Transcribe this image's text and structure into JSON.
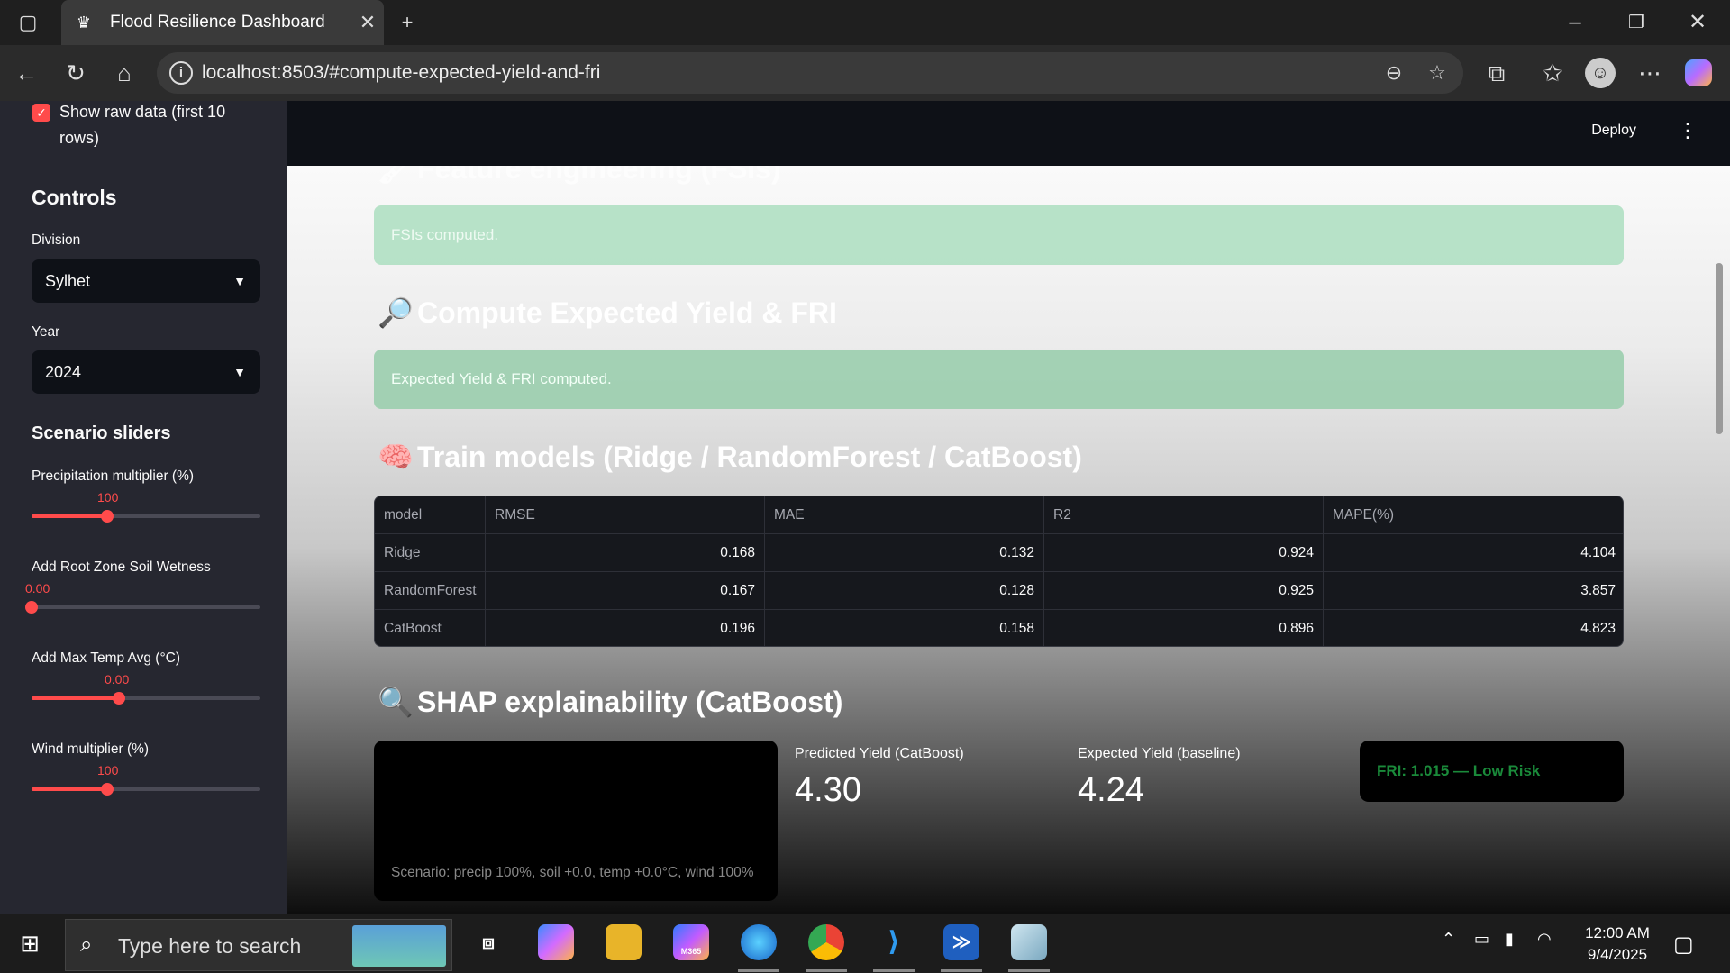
{
  "browser": {
    "tab_title": "Flood Resilience Dashboard",
    "url": "localhost:8503/#compute-expected-yield-and-fri"
  },
  "app": {
    "deploy_label": "Deploy"
  },
  "sidebar": {
    "show_raw_label": "Show raw data (first 10 rows)",
    "show_raw_checked": true,
    "controls_title": "Controls",
    "division_label": "Division",
    "division_value": "Sylhet",
    "year_label": "Year",
    "year_value": "2024",
    "scenario_title": "Scenario sliders",
    "sliders": [
      {
        "label": "Precipitation multiplier (%)",
        "value": "100",
        "fraction": 0.33
      },
      {
        "label": "Add Root Zone Soil Wetness",
        "value": "0.00",
        "fraction": 0.0
      },
      {
        "label": "Add Max Temp Avg (°C)",
        "value": "0.00",
        "fraction": 0.38
      },
      {
        "label": "Wind multiplier (%)",
        "value": "100",
        "fraction": 0.33
      }
    ]
  },
  "main": {
    "section_fsi_title": "Feature engineering (FSIs)",
    "fsi_alert": "FSIs computed.",
    "section_fri_title": "Compute Expected Yield & FRI",
    "fri_alert": "Expected Yield & FRI computed.",
    "section_train_title": "Train models (Ridge / RandomForest / CatBoost)",
    "table": {
      "columns": [
        "model",
        "RMSE",
        "MAE",
        "R2",
        "MAPE(%)"
      ],
      "rows": [
        [
          "Ridge",
          "0.168",
          "0.132",
          "0.924",
          "4.104"
        ],
        [
          "RandomForest",
          "0.167",
          "0.128",
          "0.925",
          "3.857"
        ],
        [
          "CatBoost",
          "0.196",
          "0.158",
          "0.896",
          "4.823"
        ]
      ]
    },
    "section_shap_title": "SHAP explainability (CatBoost)",
    "scenario_caption": "Scenario: precip 100%, soil +0.0, temp +0.0°C, wind 100%",
    "metric_pred_label": "Predicted Yield (CatBoost)",
    "metric_pred_value": "4.30",
    "metric_exp_label": "Expected Yield (baseline)",
    "metric_exp_value": "4.24",
    "fri_result": "FRI: 1.015 — Low Risk"
  },
  "taskbar": {
    "search_placeholder": "Type here to search",
    "time": "12:00 AM",
    "date": "9/4/2025",
    "m365_label": "M365"
  }
}
